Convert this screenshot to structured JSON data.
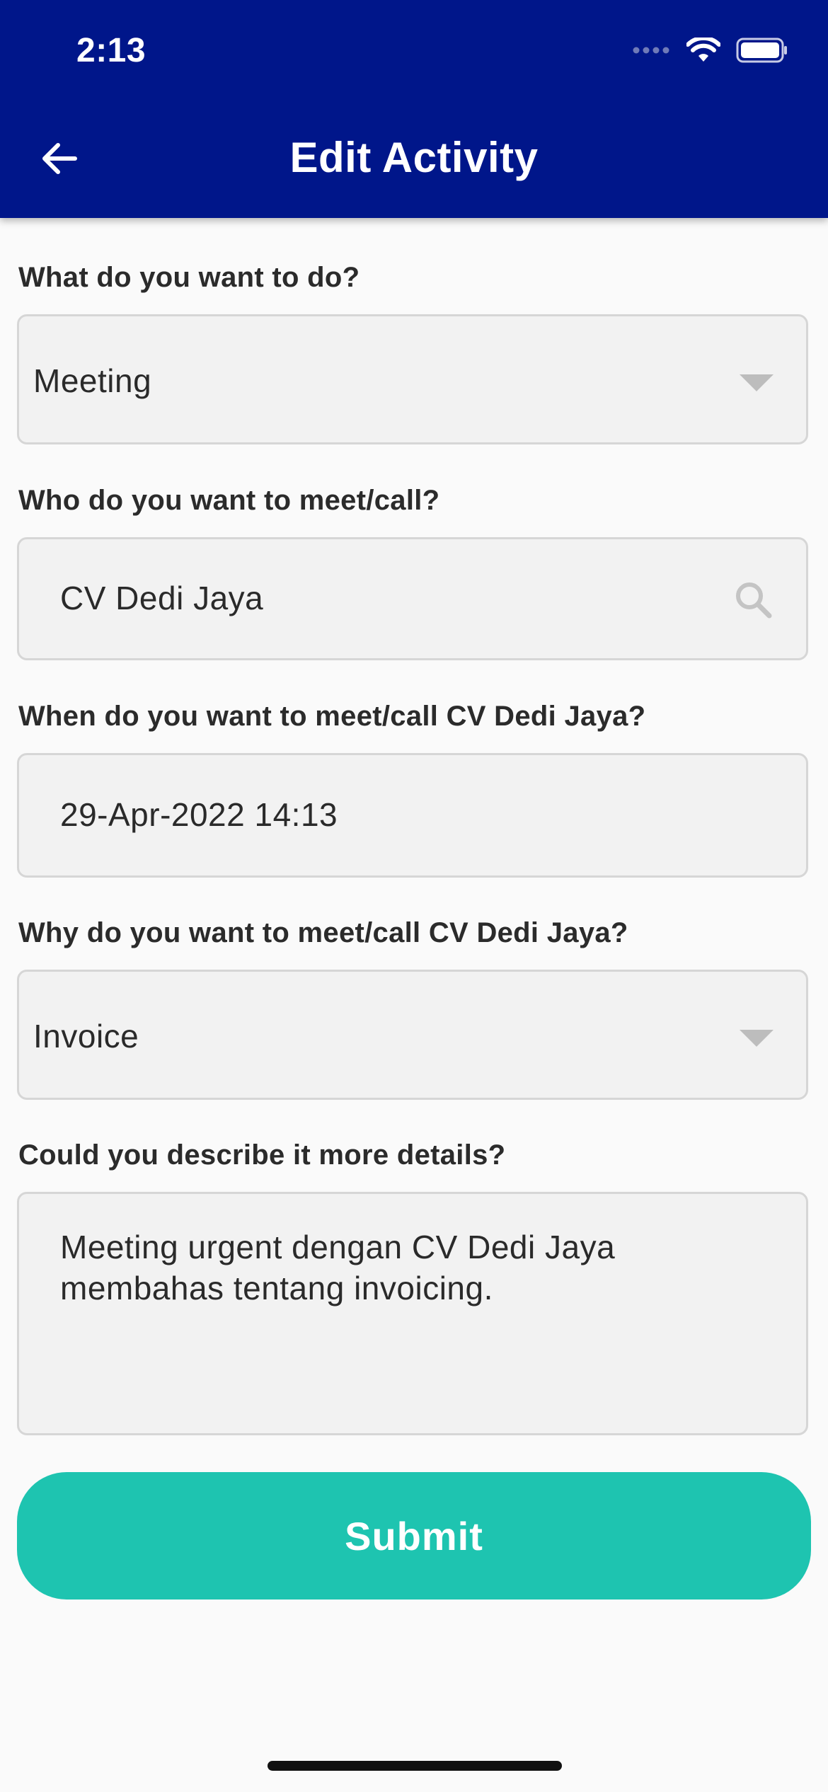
{
  "status_bar": {
    "time": "2:13",
    "icons": [
      "signal-dots-icon",
      "wifi-icon",
      "battery-icon"
    ]
  },
  "app_bar": {
    "title": "Edit Activity",
    "back_icon": "arrow-left-icon",
    "background_color": "#00168a"
  },
  "form": {
    "activity_type": {
      "label": "What do you want to do?",
      "value": "Meeting"
    },
    "contact": {
      "label": "Who do you want to meet/call?",
      "value": "CV Dedi Jaya"
    },
    "datetime": {
      "label": "When do you want to meet/call CV Dedi Jaya?",
      "value": "29-Apr-2022 14:13"
    },
    "reason": {
      "label": "Why do you want to meet/call CV Dedi Jaya?",
      "value": "Invoice"
    },
    "details": {
      "label": "Could you describe it more details?",
      "value": "Meeting urgent dengan CV Dedi Jaya\nmembahas tentang invoicing."
    },
    "submit_label": "Submit",
    "submit_color": "#1ec4b0"
  }
}
